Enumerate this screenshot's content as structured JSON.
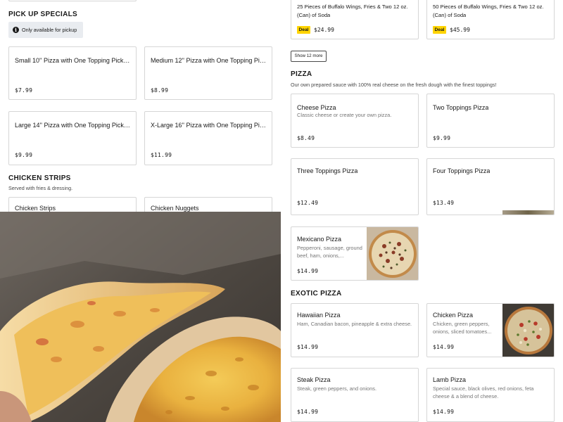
{
  "pickup": {
    "title": "PICK UP SPECIALS",
    "notice": "Only available for pickup",
    "items": [
      {
        "name": "Small 10'' Pizza with One Topping Pick Up...",
        "price": "$7.99"
      },
      {
        "name": "Medium 12'' Pizza with One Topping Pick...",
        "price": "$8.99"
      },
      {
        "name": "Large 14'' Pizza with One Topping Pick Up...",
        "price": "$9.99"
      },
      {
        "name": "X-Large 16'' Pizza with One Topping Pick ...",
        "price": "$11.99"
      }
    ]
  },
  "chicken_strips": {
    "title": "CHICKEN STRIPS",
    "subtitle": "Served with fries & dressing.",
    "items": [
      {
        "name": "Chicken Strips"
      },
      {
        "name": "Chicken Nuggets"
      }
    ]
  },
  "wings_deals": [
    {
      "name_line1": "25 Pieces of Buffalo Wings, Fries & Two 12 oz.",
      "name_line2": "(Can) of Soda",
      "badge": "Deal",
      "price": "$24.99"
    },
    {
      "name_line1": "50 Pieces of Buffalo Wings, Fries & Two 12 oz.",
      "name_line2": "(Can) of Soda",
      "badge": "Deal",
      "price": "$45.99"
    }
  ],
  "show_more_label": "Show 12 more",
  "pizza": {
    "title": "PIZZA",
    "subtitle": "Our own prepared sauce with 100% real cheese on the fresh dough with the finest toppings!",
    "items": [
      {
        "name": "Cheese Pizza",
        "desc": "Classic cheese or create your own pizza.",
        "price": "$8.49"
      },
      {
        "name": "Two Toppings Pizza",
        "price": "$9.99"
      },
      {
        "name": "Three Toppings Pizza",
        "price": "$12.49"
      },
      {
        "name": "Four Toppings Pizza",
        "price": "$13.49"
      },
      {
        "name": "Mexicano Pizza",
        "desc_line1": "Pepperoni, sausage, ground",
        "desc_line2": "beef, ham, onions,...",
        "price": "$14.99"
      }
    ]
  },
  "exotic": {
    "title": "EXOTIC PIZZA",
    "items": [
      {
        "name": "Hawaiian Pizza",
        "desc": "Ham, Canadian bacon, pineapple & extra cheese.",
        "price": "$14.99"
      },
      {
        "name": "Chicken Pizza",
        "desc_line1": "Chicken, green peppers,",
        "desc_line2": "onions, sliced tomatoes...",
        "price": "$14.99"
      },
      {
        "name": "Steak Pizza",
        "desc": "Steak, green peppers, and onions.",
        "price": "$14.99"
      },
      {
        "name": "Lamb Pizza",
        "desc_line1": "Special sauce, black olives, red onions, feta",
        "desc_line2": "cheese & a blend of cheese.",
        "price": "$14.99"
      }
    ]
  },
  "colors": {
    "deal_badge": "#ffd400",
    "border": "#d6d6d6",
    "muted_text": "#767676"
  }
}
